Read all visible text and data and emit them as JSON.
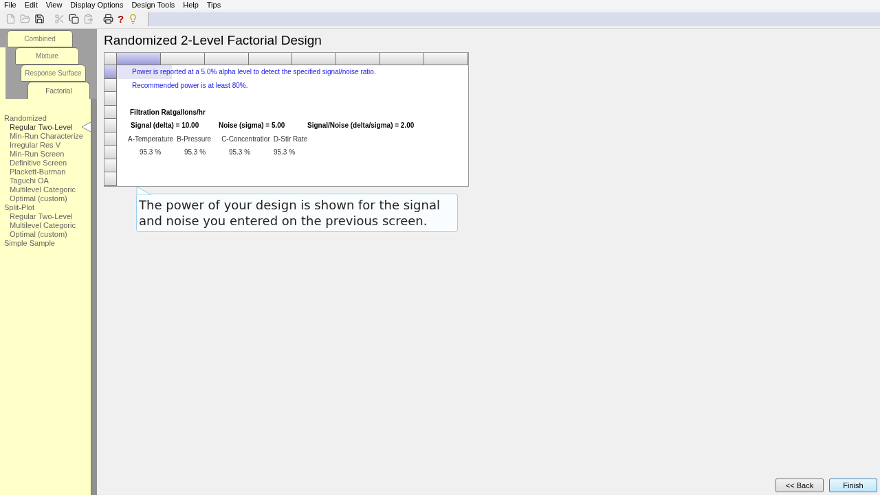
{
  "menu_bar": [
    "File",
    "Edit",
    "View",
    "Display Options",
    "Design Tools",
    "Help",
    "Tips"
  ],
  "toolbar": [
    {
      "kind": "icon",
      "disabled": true
    },
    {
      "kind": "icon",
      "disabled": true
    },
    {
      "kind": "icon",
      "disabled": false
    },
    {
      "kind": "icon",
      "disabled": true
    },
    {
      "kind": "icon",
      "disabled": false
    },
    {
      "kind": "icon",
      "disabled": true
    },
    {
      "kind": "icon",
      "disabled": false
    },
    {
      "kind": "glyph",
      "text": "?",
      "disabled": false
    },
    {
      "kind": "icon",
      "disabled": false
    }
  ],
  "sidebar": {
    "tabs": [
      {
        "label": "Combined",
        "selected": false
      },
      {
        "label": "Mixture",
        "selected": false
      },
      {
        "label": "Response Surface",
        "selected": false
      },
      {
        "label": "Factorial",
        "selected": true
      }
    ],
    "tree": [
      {
        "label": "Randomized",
        "selected": false,
        "children": [
          {
            "label": "Regular Two-Level",
            "selected": true
          },
          {
            "label": "Min-Run Characterize",
            "selected": false
          },
          {
            "label": "Irregular Res V",
            "selected": false
          },
          {
            "label": "Min-Run Screen",
            "selected": false
          },
          {
            "label": "Definitive Screen",
            "selected": false
          },
          {
            "label": "Plackett-Burman",
            "selected": false
          },
          {
            "label": "Taguchi OA",
            "selected": false
          },
          {
            "label": "Multilevel Categoric",
            "selected": false
          },
          {
            "label": "Optimal (custom)",
            "selected": false
          }
        ]
      },
      {
        "label": "Split-Plot",
        "selected": false,
        "children": [
          {
            "label": "Regular Two-Level",
            "selected": false
          },
          {
            "label": "Multilevel Categoric",
            "selected": false
          },
          {
            "label": "Optimal (custom)",
            "selected": false
          }
        ]
      },
      {
        "label": "Simple Sample",
        "selected": false
      }
    ]
  },
  "title": "Randomized 2-Level Factorial Design",
  "grid": {
    "columns": [
      {
        "selected": true
      },
      {
        "selected": false
      },
      {
        "selected": false
      },
      {
        "selected": false
      },
      {
        "selected": false
      },
      {
        "selected": false
      },
      {
        "selected": false
      },
      {
        "selected": false
      }
    ],
    "rows": [
      {
        "selected": true,
        "kind": "note",
        "cells": [
          "Power is reported at a 5.0% alpha level to detect the specified signal/noise ratio."
        ]
      },
      {
        "selected": false,
        "kind": "note",
        "cells": [
          "Recommended power is at least 80%."
        ]
      },
      {
        "selected": false,
        "kind": "empty"
      },
      {
        "selected": false,
        "kind": "heading",
        "cells": [
          "Filtration Rat",
          "gallons/hr"
        ]
      },
      {
        "selected": false,
        "kind": "stats",
        "cells": [
          "Signal (delta) = 10.00",
          "Noise (sigma) = 5.00",
          "Signal/Noise (delta/sigma) = 2.00"
        ]
      },
      {
        "selected": false,
        "kind": "factors",
        "cells": [
          "A-Temperature",
          "B-Pressure",
          "C-Concentratior",
          "D-Stir Rate"
        ]
      },
      {
        "selected": false,
        "kind": "values",
        "cells": [
          "95.3 %",
          "95.3 %",
          "95.3 %",
          "95.3 %"
        ]
      },
      {
        "selected": false,
        "kind": "empty"
      },
      {
        "selected": false,
        "kind": "empty"
      }
    ]
  },
  "callout": "The power of your design is shown for the signal and noise you entered on the previous screen.",
  "buttons": [
    {
      "label": "<< Back",
      "default": false
    },
    {
      "label": "Finish",
      "default": true
    }
  ]
}
